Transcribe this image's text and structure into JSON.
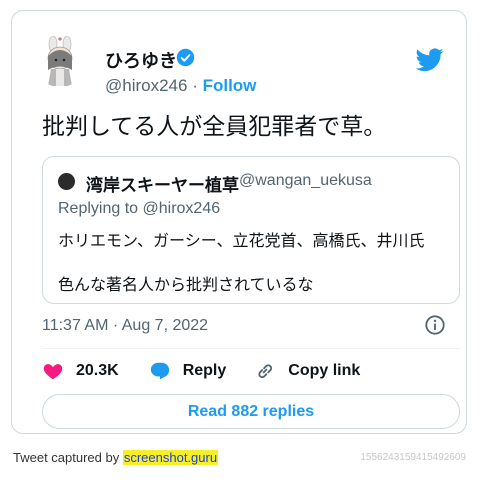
{
  "tweet": {
    "author": {
      "display_name": "ひろゆき",
      "handle": "@hirox246",
      "follow_label": "Follow",
      "separator": " · ",
      "verified": true
    },
    "text": "批判してる人が全員犯罪者で草。",
    "timestamp": "11:37 AM · Aug 7, 2022",
    "likes": "20.3K",
    "reply_label": "Reply",
    "copy_link_label": "Copy link",
    "read_replies_label": "Read 882 replies"
  },
  "quoted_tweet": {
    "display_name": "湾岸スキーヤー植草",
    "handle": "@wangan_uekusa",
    "replying_to": "Replying to @hirox246",
    "line1": "ホリエモン、ガーシー、立花党首、高橋氏、井川氏",
    "line2": "色んな著名人から批判されているな"
  },
  "footer": {
    "prefix": "Tweet captured by ",
    "brand": "screenshot.guru",
    "tweet_id": "1556243159415492609"
  },
  "colors": {
    "accent": "#1d9bf0",
    "like": "#f91880",
    "muted": "#536471",
    "border": "#cfd9de",
    "brand_highlight": "#f7ee2a"
  },
  "icons": [
    "verified-badge-icon",
    "twitter-bird-icon",
    "info-icon",
    "heart-icon",
    "reply-icon",
    "link-icon"
  ]
}
